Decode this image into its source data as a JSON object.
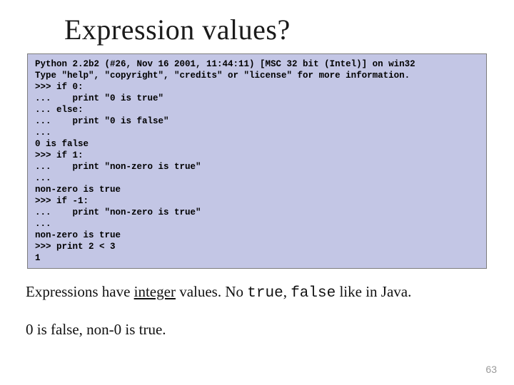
{
  "title": "Expression values?",
  "code": "Python 2.2b2 (#26, Nov 16 2001, 11:44:11) [MSC 32 bit (Intel)] on win32\nType \"help\", \"copyright\", \"credits\" or \"license\" for more information.\n>>> if 0:\n...    print \"0 is true\"\n... else:\n...    print \"0 is false\"\n...\n0 is false\n>>> if 1:\n...    print \"non-zero is true\"\n...\nnon-zero is true\n>>> if -1:\n...    print \"non-zero is true\"\n...\nnon-zero is true\n>>> print 2 < 3\n1",
  "para1": {
    "pre": "Expressions have ",
    "underline": "integer",
    "mid": " values. No ",
    "code1": "true",
    "sep": ", ",
    "code2": "false",
    "post": " like in Java."
  },
  "para2": "0 is false, non-0 is true.",
  "pagenum": "63"
}
